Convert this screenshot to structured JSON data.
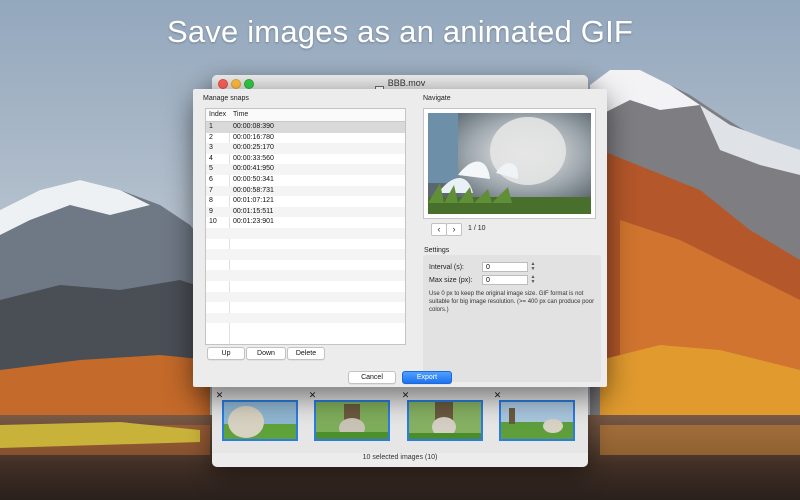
{
  "headline": "Save images as an animated GIF",
  "window": {
    "title": "BBB.mov",
    "status": "10 selected images (10)"
  },
  "sheet": {
    "manage_label": "Manage snaps",
    "navigate_label": "Navigate",
    "columns": [
      "Index",
      "Time"
    ],
    "rows": [
      {
        "index": "1",
        "time": "00:00:08:390"
      },
      {
        "index": "2",
        "time": "00:00:16:780"
      },
      {
        "index": "3",
        "time": "00:00:25:170"
      },
      {
        "index": "4",
        "time": "00:00:33:560"
      },
      {
        "index": "5",
        "time": "00:00:41:950"
      },
      {
        "index": "6",
        "time": "00:00:50:341"
      },
      {
        "index": "7",
        "time": "00:00:58:731"
      },
      {
        "index": "8",
        "time": "00:01:07:121"
      },
      {
        "index": "9",
        "time": "00:01:15:511"
      },
      {
        "index": "10",
        "time": "00:01:23:901"
      }
    ],
    "buttons": {
      "up": "Up",
      "down": "Down",
      "delete": "Delete",
      "cancel": "Cancel",
      "export": "Export"
    },
    "page_indicator": "1 / 10",
    "settings": {
      "label": "Settings",
      "interval_label": "Interval (s):",
      "interval_value": "0",
      "max_size_label": "Max size (px):",
      "max_size_value": "0",
      "help": "Use 0 px to keep the original image size. GIF format is not suitable for big image resolution. (>= 400 px can produce poor colors.)"
    }
  },
  "icons": {
    "prev": "chevron-left-icon",
    "next": "chevron-right-icon",
    "close": "close-icon",
    "stepper": "stepper-icon"
  },
  "colors": {
    "accent": "#2a7de1",
    "selection": "#d9d9d9"
  }
}
